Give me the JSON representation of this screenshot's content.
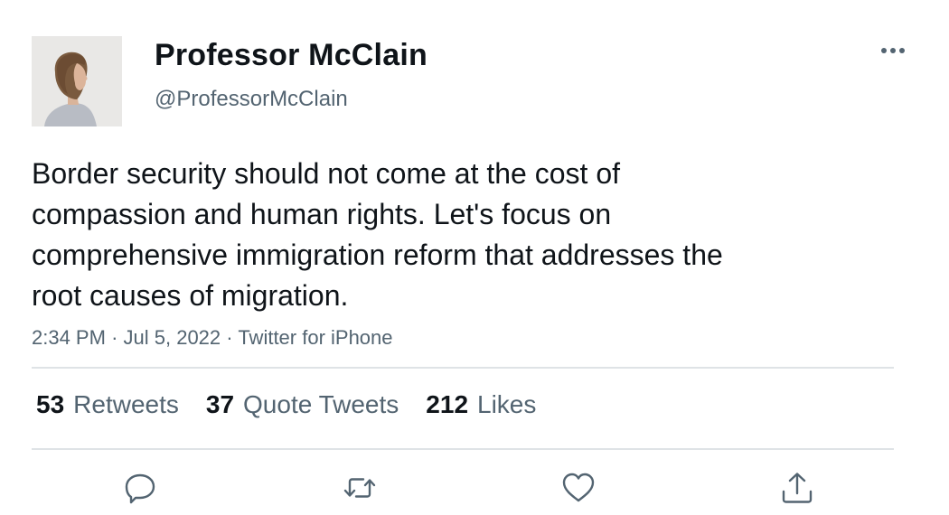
{
  "user": {
    "display_name": "Professor McClain",
    "handle": "@ProfessorMcClain"
  },
  "tweet": {
    "text_lines": [
      "Border security should not come at the cost of",
      "compassion and human rights. Let's focus on",
      "comprehensive immigration reform that addresses the",
      "root causes of migration."
    ],
    "time": "2:34 PM",
    "separator": "·",
    "date": "Jul 5, 2022",
    "source": "Twitter for iPhone"
  },
  "stats": {
    "retweets_count": "53",
    "retweets_label": "Retweets",
    "quotes_count": "37",
    "quotes_label": "Quote Tweets",
    "likes_count": "212",
    "likes_label": "Likes"
  },
  "actions": {
    "icons": [
      "reply-icon",
      "retweet-icon",
      "like-icon",
      "share-icon"
    ]
  },
  "colors": {
    "text_primary": "#0f1419",
    "text_secondary": "#536471",
    "divider": "#dfe3e6",
    "icon": "#536471"
  }
}
